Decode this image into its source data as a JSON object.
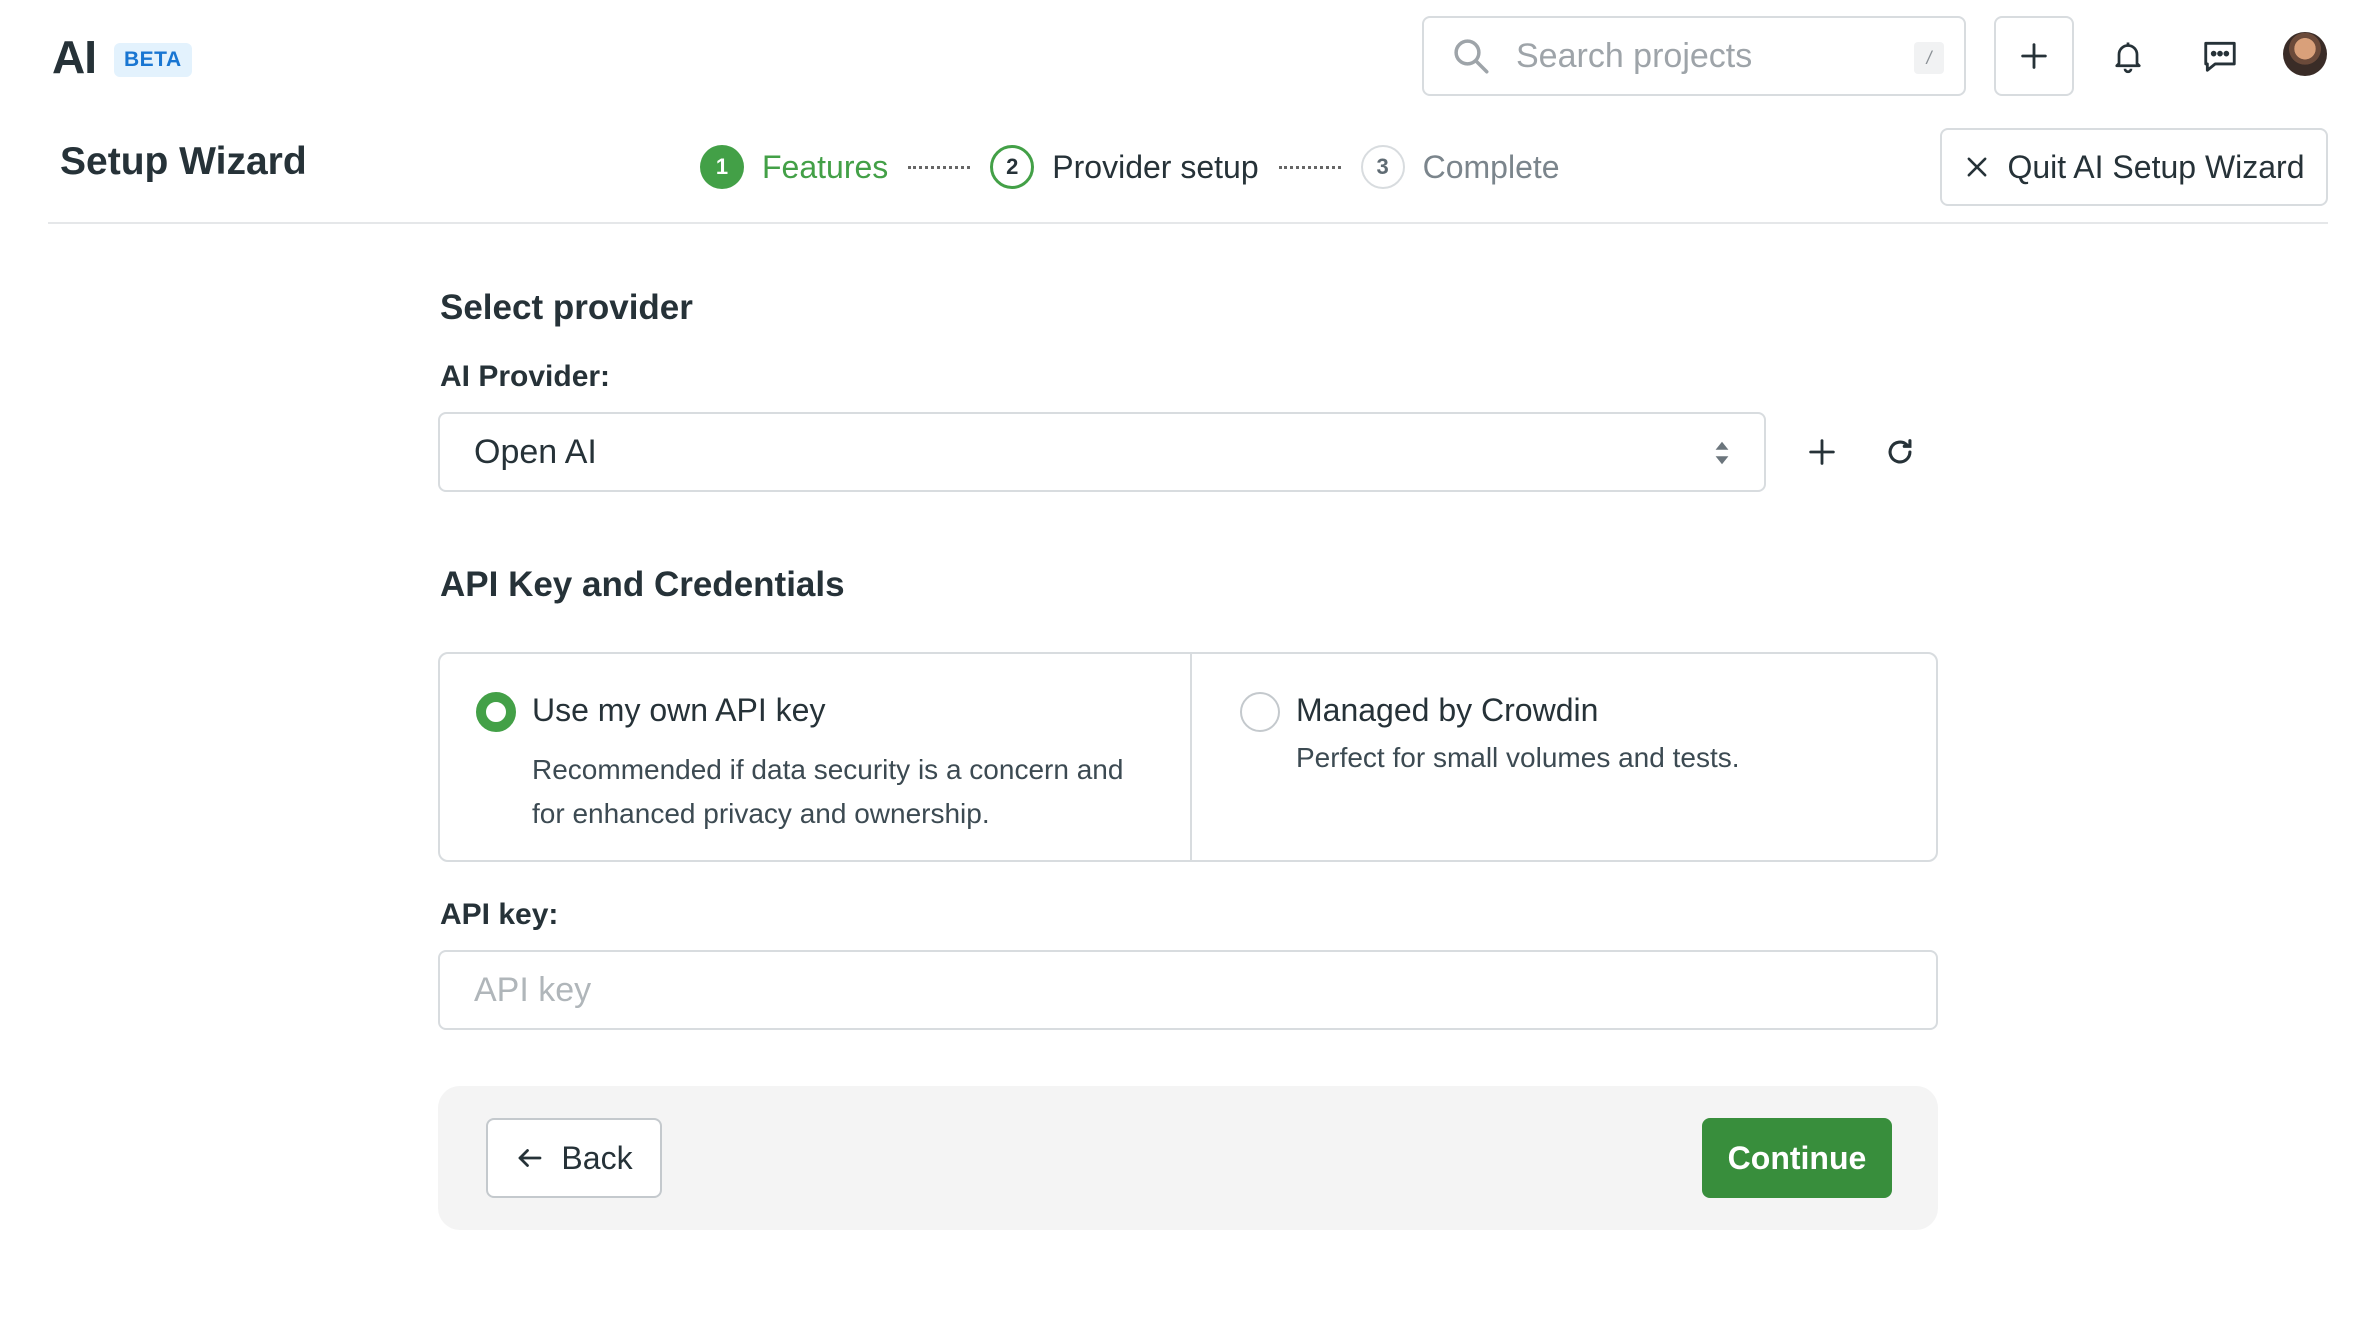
{
  "app": {
    "name": "AI",
    "badge": "BETA"
  },
  "search": {
    "placeholder": "Search projects",
    "shortcut": "/"
  },
  "header_icons": [
    "plus-icon",
    "bell-icon",
    "chat-icon",
    "avatar"
  ],
  "wizard": {
    "title": "Setup Wizard",
    "steps": [
      {
        "number": "1",
        "label": "Features",
        "state": "done"
      },
      {
        "number": "2",
        "label": "Provider setup",
        "state": "current"
      },
      {
        "number": "3",
        "label": "Complete",
        "state": "future"
      }
    ],
    "quit_label": "Quit AI Setup Wizard"
  },
  "provider": {
    "section_title": "Select provider",
    "label": "AI Provider:",
    "selected": "Open AI"
  },
  "credentials": {
    "section_title": "API Key and Credentials",
    "options": [
      {
        "title": "Use my own API key",
        "description": "Recommended if data security is a concern and for enhanced privacy and ownership.",
        "selected": true
      },
      {
        "title": "Managed by Crowdin",
        "description": "Perfect for small volumes and tests.",
        "selected": false
      }
    ]
  },
  "api_key": {
    "label": "API key:",
    "placeholder": "API key",
    "value": ""
  },
  "footer": {
    "back_label": "Back",
    "continue_label": "Continue"
  },
  "colors": {
    "accent": "#43a047",
    "primary_button": "#388e3c",
    "beta_bg": "#e3f2fd",
    "beta_text": "#1976d2"
  }
}
